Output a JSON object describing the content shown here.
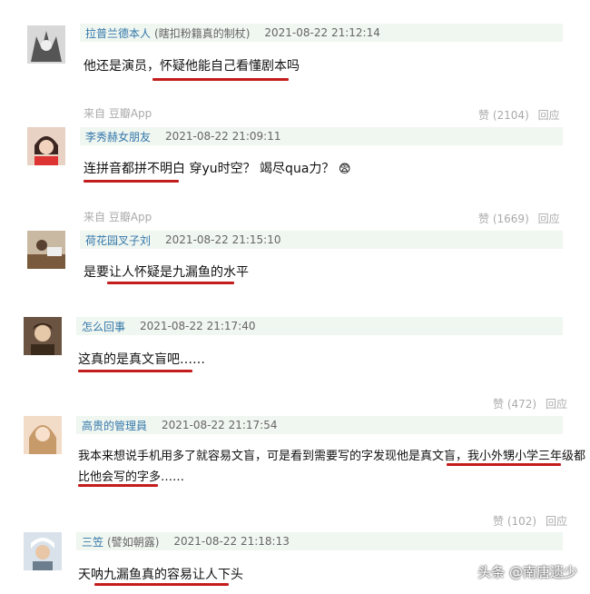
{
  "comments": [
    {
      "name": "拉普兰德本人",
      "tag": "(瞎扣粉籍真的制杖)",
      "time": "2021-08-22 21:12:14",
      "text": "他还是演员，怀疑他能自己看懂剧本吗",
      "source": "来自 豆瓣App",
      "like": "赞",
      "like_count": "(2104)",
      "reply": "回应"
    },
    {
      "name": "李秀赫女朋友",
      "time": "2021-08-22 21:09:11",
      "text": "连拼音都拼不明白 穿yu时空？ 竭尽qua力？",
      "emoji": "😨",
      "source": "来自 豆瓣App",
      "like": "赞",
      "like_count": "(1669)",
      "reply": "回应"
    },
    {
      "name": "荷花园叉子刘",
      "time": "2021-08-22 21:15:10",
      "text": "是要让人怀疑是九漏鱼的水平"
    },
    {
      "name": "怎么回事",
      "time": "2021-08-22 21:17:40",
      "text": "这真的是真文盲吧……",
      "like": "赞",
      "like_count": "(472)",
      "reply": "回应"
    },
    {
      "name": "高贵的管理員",
      "time": "2021-08-22 21:17:54",
      "text_line1": "我本来想说手机用多了就容易文盲，可是看到需要写的字发现他是真文盲，我小外甥小学三年级都",
      "text_line2": "比他会写的字多……",
      "like": "赞",
      "like_count": "(102)",
      "reply": "回应"
    },
    {
      "name": "三笠",
      "tag": "(譬如朝露)",
      "time": "2021-08-22 21:18:13",
      "text": "天呐九漏鱼真的容易让人下头"
    }
  ],
  "watermark": "头条 @南唐遗少",
  "colors": {
    "accent_underline": "#c41c1c",
    "name_link": "#3377aa",
    "meta_bg": "#f0f6f0"
  }
}
